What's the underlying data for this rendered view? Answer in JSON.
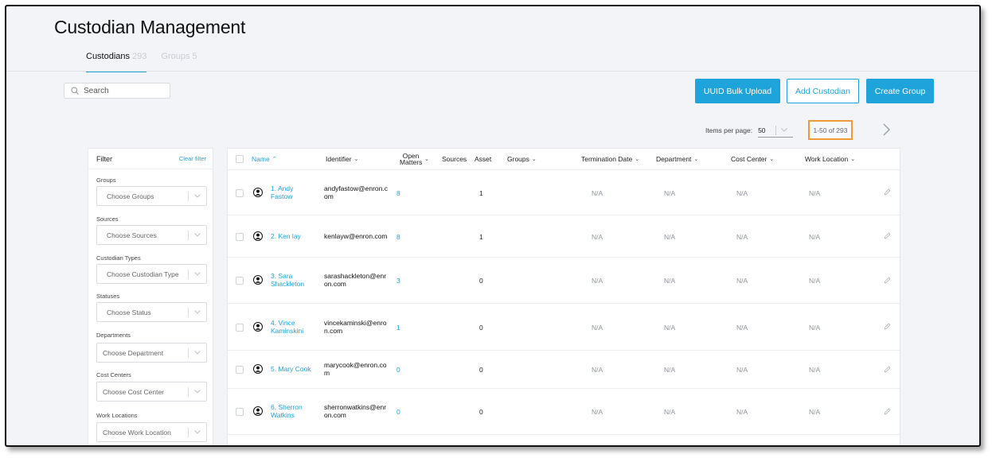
{
  "page": {
    "title": "Custodian Management"
  },
  "tabs": [
    {
      "label": "Custodians",
      "count": "293"
    },
    {
      "label": "Groups",
      "count": "5"
    }
  ],
  "search": {
    "placeholder": "Search"
  },
  "actions": {
    "uuid_bulk_upload": "UUID Bulk Upload",
    "add_custodian": "Add Custodian",
    "create_group": "Create Group"
  },
  "pagination": {
    "items_per_page_label": "Items per page:",
    "items_per_page": "50",
    "range": "1-50 of 293"
  },
  "filter": {
    "title": "Filter",
    "clear": "Clear filter",
    "groups": [
      {
        "label": "Groups",
        "placeholder": "Choose Groups"
      },
      {
        "label": "Sources",
        "placeholder": "Choose Sources"
      },
      {
        "label": "Custodian Types",
        "placeholder": "Choose Custodian Type"
      },
      {
        "label": "Statuses",
        "placeholder": "Choose Status"
      },
      {
        "label": "Departments",
        "placeholder": "Choose Department"
      },
      {
        "label": "Cost Centers",
        "placeholder": "Choose Cost Center"
      },
      {
        "label": "Work Locations",
        "placeholder": "Choose Work Location"
      }
    ]
  },
  "table": {
    "columns": {
      "name": "Name",
      "identifier": "Identifier",
      "open_matters": "Open Matters",
      "sources": "Sources",
      "asset": "Asset",
      "groups": "Groups",
      "termination_date": "Termination Date",
      "department": "Department",
      "cost_center": "Cost Center",
      "work_location": "Work Location"
    },
    "rows": [
      {
        "name": "1. Andy Fastow",
        "identifier": "andyfastow@enron.com",
        "open_matters": "8",
        "asset": "1",
        "termination_date": "N/A",
        "department": "N/A",
        "cost_center": "N/A",
        "work_location": "N/A"
      },
      {
        "name": "2. Ken lay",
        "identifier": "kenlayw@enron.com",
        "open_matters": "8",
        "asset": "1",
        "termination_date": "N/A",
        "department": "N/A",
        "cost_center": "N/A",
        "work_location": "N/A"
      },
      {
        "name": "3. Sara Shackleton",
        "identifier": "sarashackleton@enron.com",
        "open_matters": "3",
        "asset": "0",
        "termination_date": "N/A",
        "department": "N/A",
        "cost_center": "N/A",
        "work_location": "N/A"
      },
      {
        "name": "4. Vince Kaminskini",
        "identifier": "vincekaminski@enron.com",
        "open_matters": "1",
        "asset": "0",
        "termination_date": "N/A",
        "department": "N/A",
        "cost_center": "N/A",
        "work_location": "N/A"
      },
      {
        "name": "5. Mary Cook",
        "identifier": "marycook@enron.com",
        "open_matters": "0",
        "asset": "0",
        "termination_date": "N/A",
        "department": "N/A",
        "cost_center": "N/A",
        "work_location": "N/A"
      },
      {
        "name": "6. Sherron Watkins",
        "identifier": "sherronwatkins@enron.com",
        "open_matters": "0",
        "asset": "0",
        "termination_date": "N/A",
        "department": "N/A",
        "cost_center": "N/A",
        "work_location": "N/A"
      }
    ]
  },
  "colors": {
    "accent": "#1fa3db",
    "highlight": "#f29a38"
  }
}
